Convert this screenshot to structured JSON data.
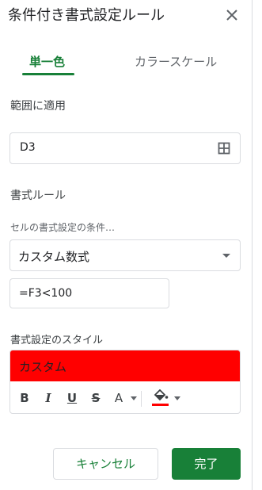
{
  "panel": {
    "title": "条件付き書式設定ルール"
  },
  "tabs": [
    {
      "label": "単一色",
      "active": true
    },
    {
      "label": "カラースケール",
      "active": false
    }
  ],
  "apply_range": {
    "label": "範囲に適用",
    "value": "D3"
  },
  "format_rules": {
    "label": "書式ルール",
    "condition_label": "セルの書式設定の条件…",
    "condition_value": "カスタム数式",
    "formula_value": "=F3<100"
  },
  "format_style": {
    "label": "書式設定のスタイル",
    "preview_text": "カスタム",
    "preview_color": "#ff0000",
    "toolbar": {
      "bold": "B",
      "italic": "I",
      "underline": "U",
      "strikethrough": "S",
      "text_color": "A",
      "fill_color_swatch": "#ff0000"
    }
  },
  "actions": {
    "cancel_label": "キャンセル",
    "done_label": "完了"
  },
  "colors": {
    "accent": "#188038",
    "border": "#dadce0"
  }
}
